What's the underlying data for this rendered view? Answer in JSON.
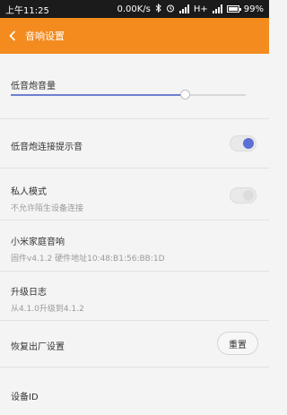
{
  "status_bar": {
    "time": "上午11:25",
    "network_speed": "0.00K/s",
    "network_type": "H+",
    "battery_percent": "99%",
    "battery_level": 0.99,
    "icons": [
      "bluetooth-icon",
      "alarm-icon",
      "signal-icon",
      "battery-icon"
    ]
  },
  "header": {
    "title": "音响设置",
    "back_icon": "chevron-left-icon",
    "color": "#f38b1f"
  },
  "settings": {
    "subwoofer_volume": {
      "label": "低音炮音量",
      "level": 0.74
    },
    "subwoofer_tone": {
      "label": "低音炮连接提示音",
      "enabled": true
    },
    "private_mode": {
      "label": "私人模式",
      "description": "不允许陌生设备连接",
      "enabled": false
    },
    "speaker_info": {
      "label": "小米家庭音响",
      "description": "固件v4.1.2  硬件地址10:48:B1:56:BB:1D"
    },
    "upgrade_log": {
      "label": "升级日志",
      "description": "从4.1.0升级到4.1.2"
    },
    "factory_reset": {
      "label": "恢复出厂设置",
      "button_label": "重置"
    },
    "device_id": {
      "label": "设备ID"
    }
  },
  "colors": {
    "accent": "#5b6fd6",
    "background": "#f4f4f4"
  }
}
